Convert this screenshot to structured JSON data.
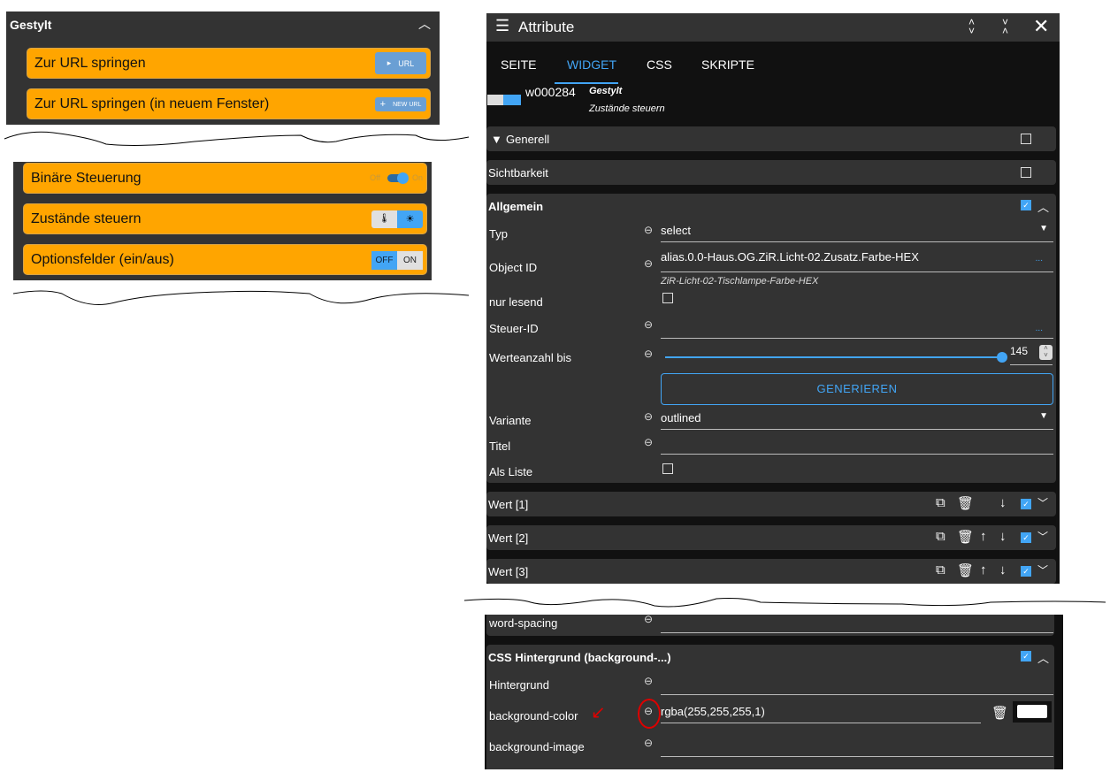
{
  "left_widgets": {
    "title": "Gestylt",
    "rows": [
      {
        "label": "Zur URL springen",
        "button": "URL"
      },
      {
        "label": "Zur URL springen (in neuem Fenster)",
        "button": "NEW URL"
      }
    ],
    "rows2": [
      {
        "label": "Binäre Steuerung",
        "off": "Off",
        "on": "On"
      },
      {
        "label": "Zustände steuern"
      },
      {
        "label": "Optionsfelder (ein/aus)",
        "off": "OFF",
        "on": "ON"
      }
    ]
  },
  "panel": {
    "title": "Attribute",
    "tabs": [
      "SEITE",
      "WIDGET",
      "CSS",
      "SKRIPTE"
    ],
    "active_tab": "WIDGET",
    "widget_id": "w000284",
    "widget_set": "Gestylt",
    "widget_name": "Zustände steuern",
    "sections": {
      "generell": "Generell",
      "sichtbarkeit": "Sichtbarkeit",
      "allgemein": "Allgemein"
    },
    "fields": {
      "typ_label": "Typ",
      "typ_value": "select",
      "oid_label": "Object ID",
      "oid_value": "alias.0.0-Haus.OG.ZiR.Licht-02.Zusatz.Farbe-HEX",
      "oid_name": "ZiR-Licht-02-Tischlampe-Farbe-HEX",
      "more": "...",
      "readonly_label": "nur lesend",
      "control_label": "Steuer-ID",
      "count_label": "Werteanzahl bis",
      "count_value": "145",
      "count_fraction": 1.0,
      "generate": "GENERIEREN",
      "variant_label": "Variante",
      "variant_value": "outlined",
      "title_label": "Titel",
      "list_label": "Als Liste"
    },
    "values": [
      "Wert [1]",
      "Wert [2]",
      "Wert [3]"
    ]
  },
  "css_panel": {
    "word_spacing": "word-spacing",
    "section": "CSS Hintergrund (background-...)",
    "bg_label": "Hintergrund",
    "bgcolor_label": "background-color",
    "bgcolor_value": "rgba(255,255,255,1)",
    "bgimage_label": "background-image"
  },
  "colors": {
    "accent": "#42a5f5",
    "orange": "#ffa500"
  }
}
